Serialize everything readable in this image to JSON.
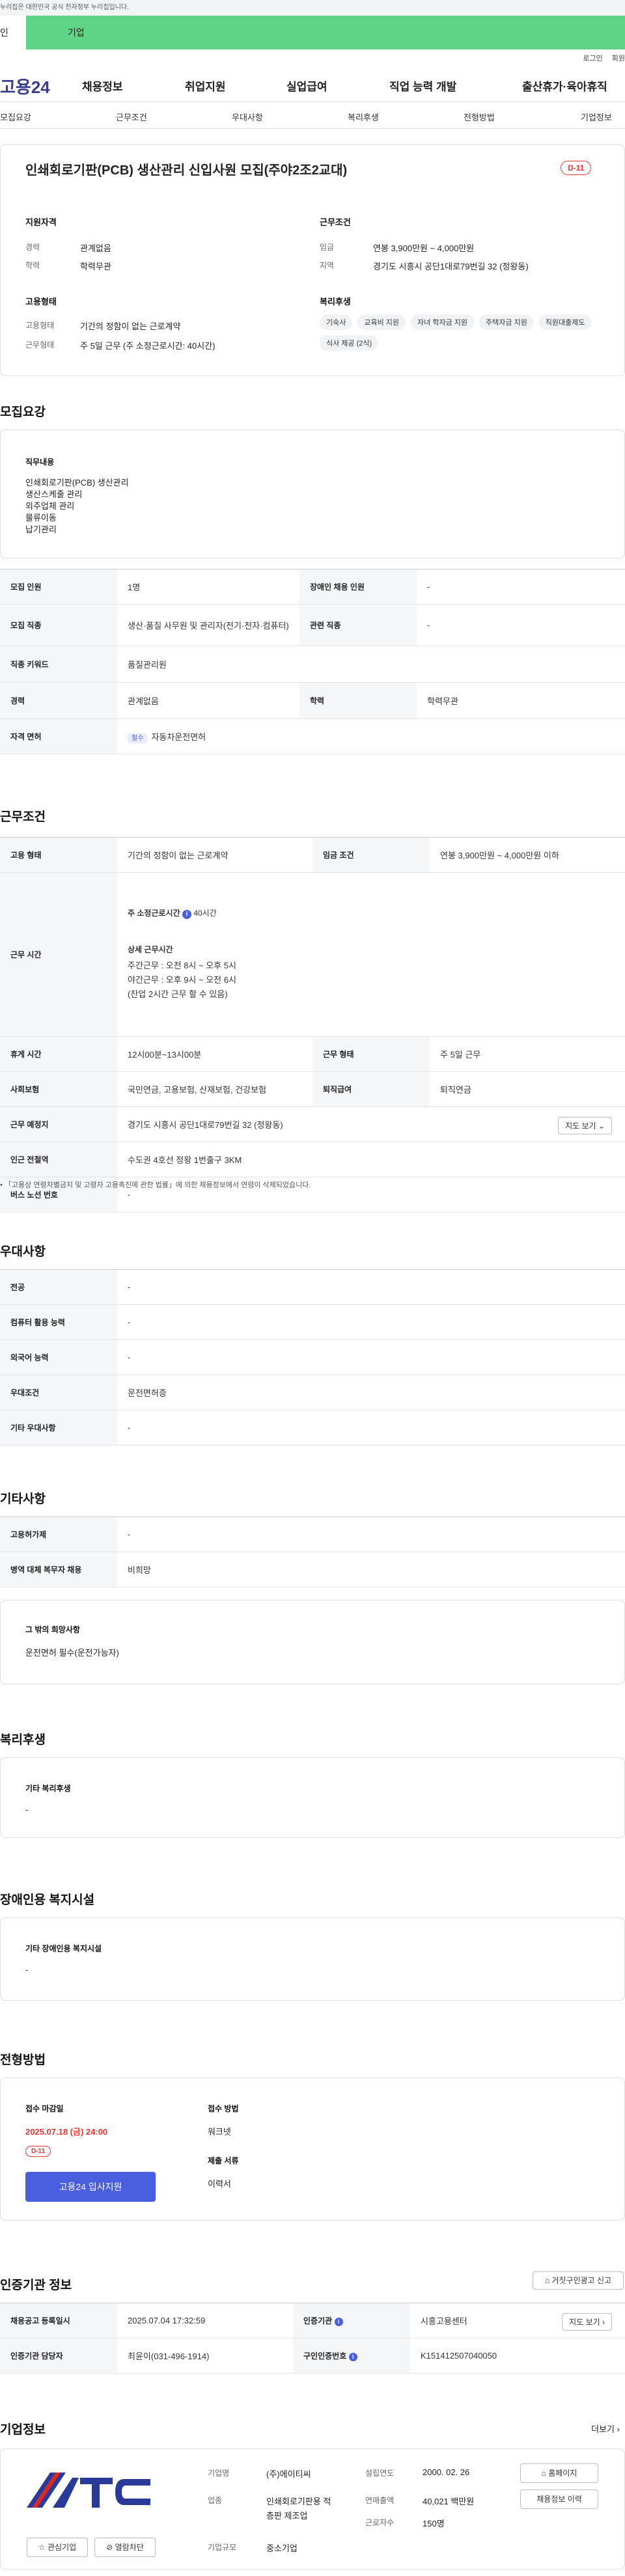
{
  "gov_notice": "누리집은 대한민국 공식 전자정부 누리집입니다.",
  "top_tabs": {
    "person": "인",
    "company": "기업"
  },
  "util": {
    "login": "로그인",
    "join": "회원"
  },
  "logo": "고용24",
  "gnb": [
    "채용정보",
    "취업지원",
    "실업급여",
    "직업 능력 개발",
    "출산휴가·육아휴직"
  ],
  "sub_tabs": [
    "모집요강",
    "근무조건",
    "우대사항",
    "복리후생",
    "전형방법",
    "기업정보"
  ],
  "job": {
    "title": "인쇄회로기판(PCB) 생산관리 신입사원 모집(주야2조2교대)",
    "dday": "D-11",
    "qual_title": "지원자격",
    "career_l": "경력",
    "career_v": "관계없음",
    "edu_l": "학력",
    "edu_v": "학력무관",
    "cond_title": "근무조건",
    "wage_l": "임금",
    "wage_v": "연봉 3,900만원 ~ 4,000만원",
    "region_l": "지역",
    "region_v": "경기도 시흥시 공단1대로79번길 32 (정왕동)",
    "emp_title": "고용형태",
    "emp_l": "고용형태",
    "emp_v": "기간의 정함이 없는 근로계약",
    "work_l": "근무형태",
    "work_v": "주 5일 근무 (주 소정근로시간: 40시간)",
    "welfare_title": "복리후생",
    "welfare_chips": [
      "기숙사",
      "교육비 지원",
      "자녀 학자금 지원",
      "주택자금 지원",
      "직원대출제도",
      "식사 제공 (2식)"
    ]
  },
  "recruit": {
    "title": "모집요강",
    "duty_label": "직무내용",
    "duties": [
      "인쇄회로기판(PCB) 생산관리",
      "생산스케줄 관리",
      "외주업체 관리",
      "물류이동",
      "납기관리"
    ],
    "rows": {
      "count_l": "모집 인원",
      "count_v": "1명",
      "dis_l": "장애인 채용 인원",
      "dis_v": "-",
      "job_l": "모집 직종",
      "job_v": "생산·품질 사무원 및 관리자(전기·전자·컴퓨터)",
      "rel_l": "관련 직종",
      "rel_v": "-",
      "kw_l": "직종 키워드",
      "kw_v": "품질관리원",
      "career_l": "경력",
      "career_v": "관계없음",
      "edu_l": "학력",
      "edu_v": "학력무관",
      "lic_l": "자격 면허",
      "lic_tag": "필수",
      "lic_v": "자동차운전면허"
    }
  },
  "work": {
    "title": "근무조건",
    "type_l": "고용 형태",
    "type_v": "기간의 정함이 없는 근로계약",
    "wage_l": "임금 조건",
    "wage_v": "연봉 3,900만원 ~ 4,000만원 이하",
    "hours_l": "근무 시간",
    "hours_main": "주 소정근로시간",
    "hours_num": "40시간",
    "detail_t": "상세 근무시간",
    "detail1": "주간근무 : 오전 8시 ~ 오후 5시",
    "detail2": "야간근무 : 오후 9시 ~ 오전 6시",
    "detail3": "(잔업 2시간 근무 할 수 있음)",
    "rest_l": "휴게 시간",
    "rest_v": "12시00분~13시00분",
    "form_l": "근무 형태",
    "form_v": "주 5일 근무",
    "ins_l": "사회보험",
    "ins_v": "국민연금, 고용보험, 산재보험, 건강보험",
    "sev_l": "퇴직급여",
    "sev_v": "퇴직연금",
    "place_l": "근무 예정지",
    "place_v": "경기도 시흥시 공단1대로79번길 32 (정왕동)",
    "map_btn": "지도 보기",
    "sub_l": "인근 전철역",
    "sub_v": "수도권 4호선 정왕 1번출구 3KM",
    "bus_l": "버스 노선 번호",
    "bus_v": "-",
    "note": "「고용상 연령차별금지 및 고령자 고용촉진에 관한 법률」에 의한 채용정보에서 연령이 삭제되었습니다."
  },
  "pref": {
    "title": "우대사항",
    "rows": [
      [
        "전공",
        "-"
      ],
      [
        "컴퓨터 활용 능력",
        "-"
      ],
      [
        "외국어 능력",
        "-"
      ],
      [
        "우대조건",
        "운전면허증"
      ],
      [
        "기타 우대사항",
        "-"
      ]
    ]
  },
  "etc": {
    "title": "기타사항",
    "rows": [
      [
        "고용허가제",
        "-"
      ],
      [
        "병역 대체 복무자 채용",
        "비희망"
      ]
    ],
    "wish_t": "그 밖의 희망사항",
    "wish_v": "운전면허 필수(운전가능자)"
  },
  "welfare": {
    "title": "복리후생",
    "label": "기타 복리후생",
    "value": "-"
  },
  "disab": {
    "title": "장애인용 복지시설",
    "label": "기타 장애인용 복지시설",
    "value": "-"
  },
  "process": {
    "title": "전형방법",
    "deadline_l": "접수 마감일",
    "deadline_v": "2025.07.18 (금) 24:00",
    "dday": "D-11",
    "apply_btn": "고용24 입사지원",
    "method_l": "접수 방법",
    "method_v": "워크넷",
    "docs_l": "제출 서류",
    "docs_v": "이력서"
  },
  "agency": {
    "title": "인증기관 정보",
    "report_btn": "거짓구인광고 신고",
    "reg_l": "채용공고 등록일시",
    "reg_v": "2025.07.04 17:32:59",
    "org_l": "인증기관",
    "org_v": "시흥고용센터",
    "map_btn": "지도 보기",
    "mgr_l": "인증기관 담당자",
    "mgr_v": "최윤이(031-496-1914)",
    "num_l": "구인인증번호",
    "num_v": "K151412507040050"
  },
  "company": {
    "title": "기업정보",
    "more": "더보기",
    "name_l": "기업명",
    "name_v": "(주)에이티씨",
    "found_l": "설립연도",
    "found_v": "2000. 02. 26",
    "home_btn": "홈페이지",
    "ind_l": "업종",
    "ind_v": "인쇄회로기판용 적층판 제조업",
    "sales_l": "연매출액",
    "sales_v": "40,021 백만원",
    "hist_btn": "채용정보 이력",
    "size_l": "기업규모",
    "size_v": "중소기업",
    "staff_l": "근로자수",
    "staff_v": "150명",
    "fav_btn": "관심기업",
    "block_btn": "열람차단",
    "logo_text": "ATC"
  }
}
